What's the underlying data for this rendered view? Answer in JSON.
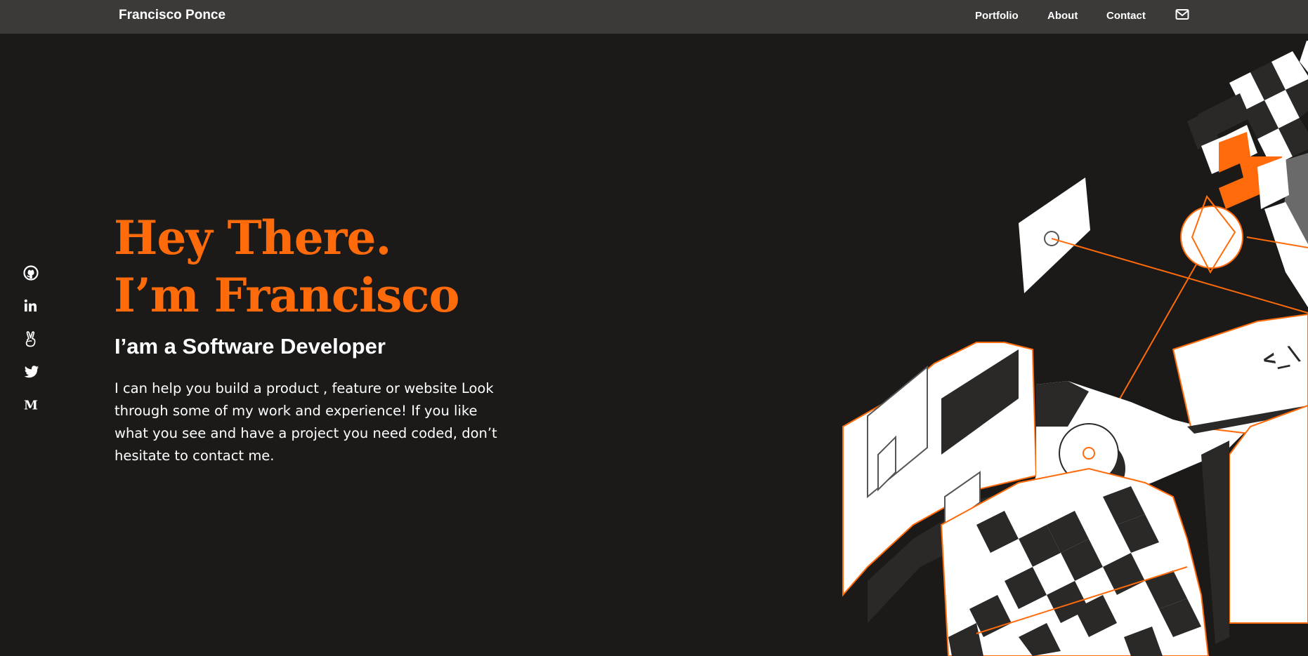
{
  "header": {
    "brand": "Francisco Ponce",
    "nav": {
      "portfolio": "Portfolio",
      "about": "About",
      "contact": "Contact"
    },
    "mail_icon": "envelope-icon"
  },
  "social_icons": [
    "github-icon",
    "linkedin-icon",
    "angellist-icon",
    "twitter-icon",
    "medium-icon"
  ],
  "hero": {
    "title_line1": "Hey There.",
    "title_line2": "I’m Francisco",
    "subtitle": "I’am a Software Developer",
    "description": "I can help you build a product , feature or website Look through some of my work and experience! If you like what you see and have a project you need coded, don’t hesitate to contact me."
  },
  "illustration": {
    "code_text": "<_\\"
  },
  "colors": {
    "background": "#1b1a19",
    "header": "#3b3a39",
    "accent": "#ff6b0a",
    "text": "#ffffff"
  }
}
